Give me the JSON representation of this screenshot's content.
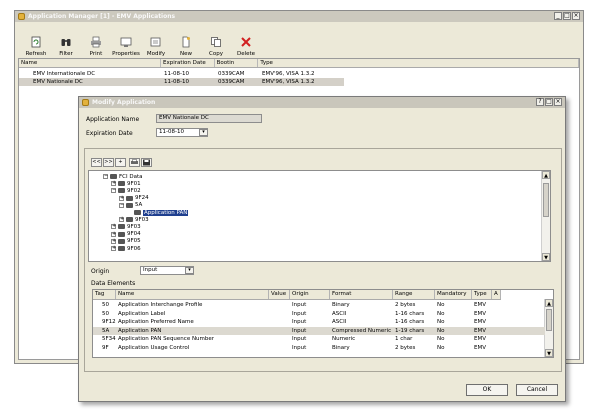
{
  "main_window": {
    "title": "Application Manager [1] - EMV Applications",
    "controls": {
      "minimize": "_",
      "maximize": "□",
      "close": "×"
    },
    "toolbar": [
      {
        "label": "Refresh",
        "icon": "refresh-icon"
      },
      {
        "label": "Filter",
        "icon": "binoculars-icon"
      },
      {
        "label": "Print",
        "icon": "printer-icon"
      },
      {
        "label": "Properties",
        "icon": "properties-icon"
      },
      {
        "label": "Modify",
        "icon": "modify-icon"
      },
      {
        "label": "New",
        "icon": "new-document-icon"
      },
      {
        "label": "Copy",
        "icon": "copy-icon"
      },
      {
        "label": "Delete",
        "icon": "delete-x-icon"
      }
    ],
    "list": {
      "columns": [
        "Name",
        "Expiration Date",
        "Bootin",
        "Type"
      ],
      "rows": [
        {
          "name": "EMV Internationale DC",
          "expiration": "11-08-10",
          "bootin": "0339CAM",
          "type": "EMV'96, VISA 1.3.2",
          "selected": false
        },
        {
          "name": "EMV Nationale DC",
          "expiration": "11-08-10",
          "bootin": "0339CAM",
          "type": "EMV'96, VISA 1.3.2",
          "selected": true
        }
      ]
    }
  },
  "dialog": {
    "title": "Modify Application",
    "controls": {
      "help": "?",
      "maximize": "□",
      "close": "×"
    },
    "application_name_label": "Application Name",
    "application_name_value": "EMV Nationale DC",
    "expiration_date_label": "Expiration Date",
    "expiration_date_value": "11-08-10",
    "tree_toolbar": [
      "<<",
      ">>",
      "+"
    ],
    "tree": [
      {
        "label": "FCI Data",
        "toggle": "−",
        "level": 0
      },
      {
        "label": "9F01",
        "toggle": "+",
        "level": 1
      },
      {
        "label": "9F02",
        "toggle": "−",
        "level": 1
      },
      {
        "label": "9F24",
        "toggle": "+",
        "level": 2
      },
      {
        "label": "5A",
        "toggle": "−",
        "level": 2
      },
      {
        "label": "Application PAN",
        "toggle": "",
        "level": 3,
        "selected": true
      },
      {
        "label": "9F03",
        "toggle": "+",
        "level": 2
      },
      {
        "label": "9F03",
        "toggle": "+",
        "level": 1
      },
      {
        "label": "9F04",
        "toggle": "+",
        "level": 1
      },
      {
        "label": "9F05",
        "toggle": "+",
        "level": 1
      },
      {
        "label": "9F06",
        "toggle": "+",
        "level": 1
      }
    ],
    "origin_label": "Origin",
    "origin_value": "Input",
    "data_elements_label": "Data Elements",
    "grid": {
      "columns": [
        "Tag",
        "Name",
        "Value",
        "Origin",
        "Format",
        "Range",
        "Mandatory",
        "Type",
        "A"
      ],
      "rows": [
        {
          "tag": "50",
          "name": "Application Interchange Profile",
          "value": "",
          "origin": "Input",
          "format": "Binary",
          "range": "2 bytes",
          "mandatory": "No",
          "type": "EMV",
          "selected": false
        },
        {
          "tag": "50",
          "name": "Application Label",
          "value": "",
          "origin": "Input",
          "format": "ASCII",
          "range": "1-16 chars",
          "mandatory": "No",
          "type": "EMV",
          "selected": false
        },
        {
          "tag": "9F12",
          "name": "Application Preferred Name",
          "value": "",
          "origin": "Input",
          "format": "ASCII",
          "range": "1-16 chars",
          "mandatory": "No",
          "type": "EMV",
          "selected": false
        },
        {
          "tag": "5A",
          "name": "Application PAN",
          "value": "",
          "origin": "Input",
          "format": "Compressed Numeric",
          "range": "1-19 chars",
          "mandatory": "No",
          "type": "EMV",
          "selected": true
        },
        {
          "tag": "5F34",
          "name": "Application PAN Sequence Number",
          "value": "",
          "origin": "Input",
          "format": "Numeric",
          "range": "1 char",
          "mandatory": "No",
          "type": "EMV",
          "selected": false
        },
        {
          "tag": "9F",
          "name": "Application Usage Control",
          "value": "",
          "origin": "Input",
          "format": "Binary",
          "range": "2 bytes",
          "mandatory": "No",
          "type": "EMV",
          "selected": false
        }
      ]
    },
    "ok_label": "OK",
    "cancel_label": "Cancel"
  }
}
